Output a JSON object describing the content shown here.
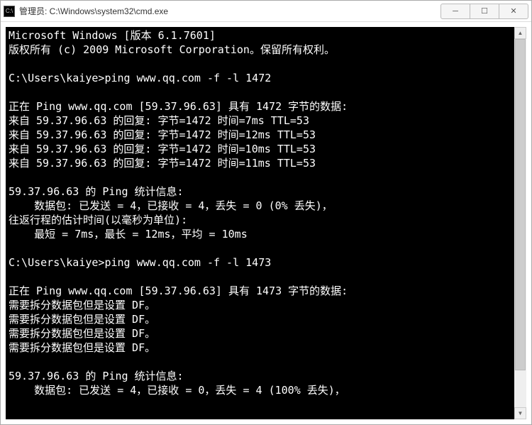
{
  "titlebar": {
    "title": "管理员: C:\\Windows\\system32\\cmd.exe"
  },
  "controls": {
    "minimize": "─",
    "maximize": "☐",
    "close": "✕"
  },
  "terminal": {
    "lines": [
      "Microsoft Windows [版本 6.1.7601]",
      "版权所有 (c) 2009 Microsoft Corporation。保留所有权利。",
      "",
      "C:\\Users\\kaiye>ping www.qq.com -f -l 1472",
      "",
      "正在 Ping www.qq.com [59.37.96.63] 具有 1472 字节的数据:",
      "来自 59.37.96.63 的回复: 字节=1472 时间=7ms TTL=53",
      "来自 59.37.96.63 的回复: 字节=1472 时间=12ms TTL=53",
      "来自 59.37.96.63 的回复: 字节=1472 时间=10ms TTL=53",
      "来自 59.37.96.63 的回复: 字节=1472 时间=11ms TTL=53",
      "",
      "59.37.96.63 的 Ping 统计信息:",
      "    数据包: 已发送 = 4，已接收 = 4，丢失 = 0 (0% 丢失)，",
      "往返行程的估计时间(以毫秒为单位):",
      "    最短 = 7ms，最长 = 12ms，平均 = 10ms",
      "",
      "C:\\Users\\kaiye>ping www.qq.com -f -l 1473",
      "",
      "正在 Ping www.qq.com [59.37.96.63] 具有 1473 字节的数据:",
      "需要拆分数据包但是设置 DF。",
      "需要拆分数据包但是设置 DF。",
      "需要拆分数据包但是设置 DF。",
      "需要拆分数据包但是设置 DF。",
      "",
      "59.37.96.63 的 Ping 统计信息:",
      "    数据包: 已发送 = 4，已接收 = 0，丢失 = 4 (100% 丢失)，"
    ]
  }
}
